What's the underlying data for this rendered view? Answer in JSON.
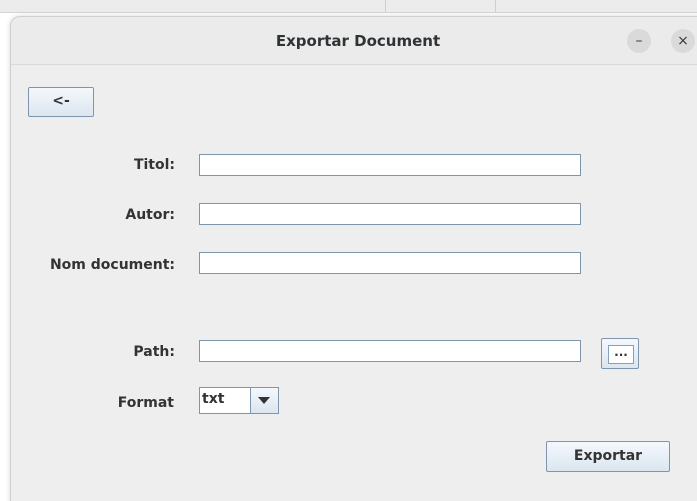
{
  "window": {
    "title": "Exportar Document",
    "minimize_glyph": "–",
    "close_glyph": "×"
  },
  "toolbar": {
    "back_label": "<-"
  },
  "form": {
    "titol_label": "Titol:",
    "titol_value": "",
    "autor_label": "Autor:",
    "autor_value": "",
    "nom_label": "Nom document:",
    "nom_value": "",
    "path_label": "Path:",
    "path_value": "",
    "browse_label": "...",
    "format_label": "Format",
    "format_value": "txt",
    "export_label": "Exportar"
  },
  "icons": {
    "dropdown": "chevron-down-icon"
  },
  "colors": {
    "button_border": "#7f95ab",
    "dialog_bg": "#eeeeee"
  }
}
